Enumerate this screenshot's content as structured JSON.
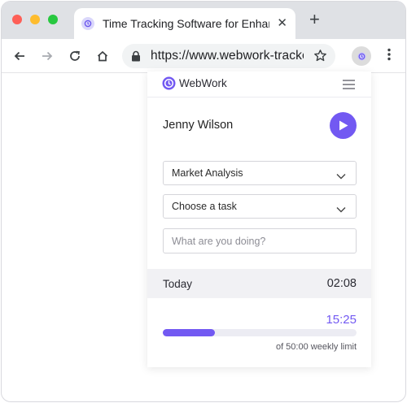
{
  "browser": {
    "tab_title": "Time Tracking Software for Enhance",
    "url": "https://www.webwork-tracker.com",
    "new_tab_label": "+",
    "close_tab_label": "✕"
  },
  "popup": {
    "brand": "WebWork",
    "user_name": "Jenny Wilson",
    "project_select": "Market Analysis",
    "task_select": "Choose a task",
    "activity_placeholder": "What are you doing?",
    "today_label": "Today",
    "today_time": "02:08",
    "weekly_time": "15:25",
    "weekly_limit_text": "of 50:00 weekly limit",
    "weekly_progress": 0.27
  },
  "colors": {
    "accent": "#7259f2",
    "track": "#ececf3",
    "today_bg": "#f1f1f4"
  },
  "icons": [
    "back-arrow-icon",
    "forward-arrow-icon",
    "reload-icon",
    "home-icon",
    "lock-icon",
    "star-icon",
    "webwork-logo-icon",
    "hamburger-menu-icon",
    "play-icon",
    "chevron-down-icon",
    "kebab-menu-icon"
  ]
}
